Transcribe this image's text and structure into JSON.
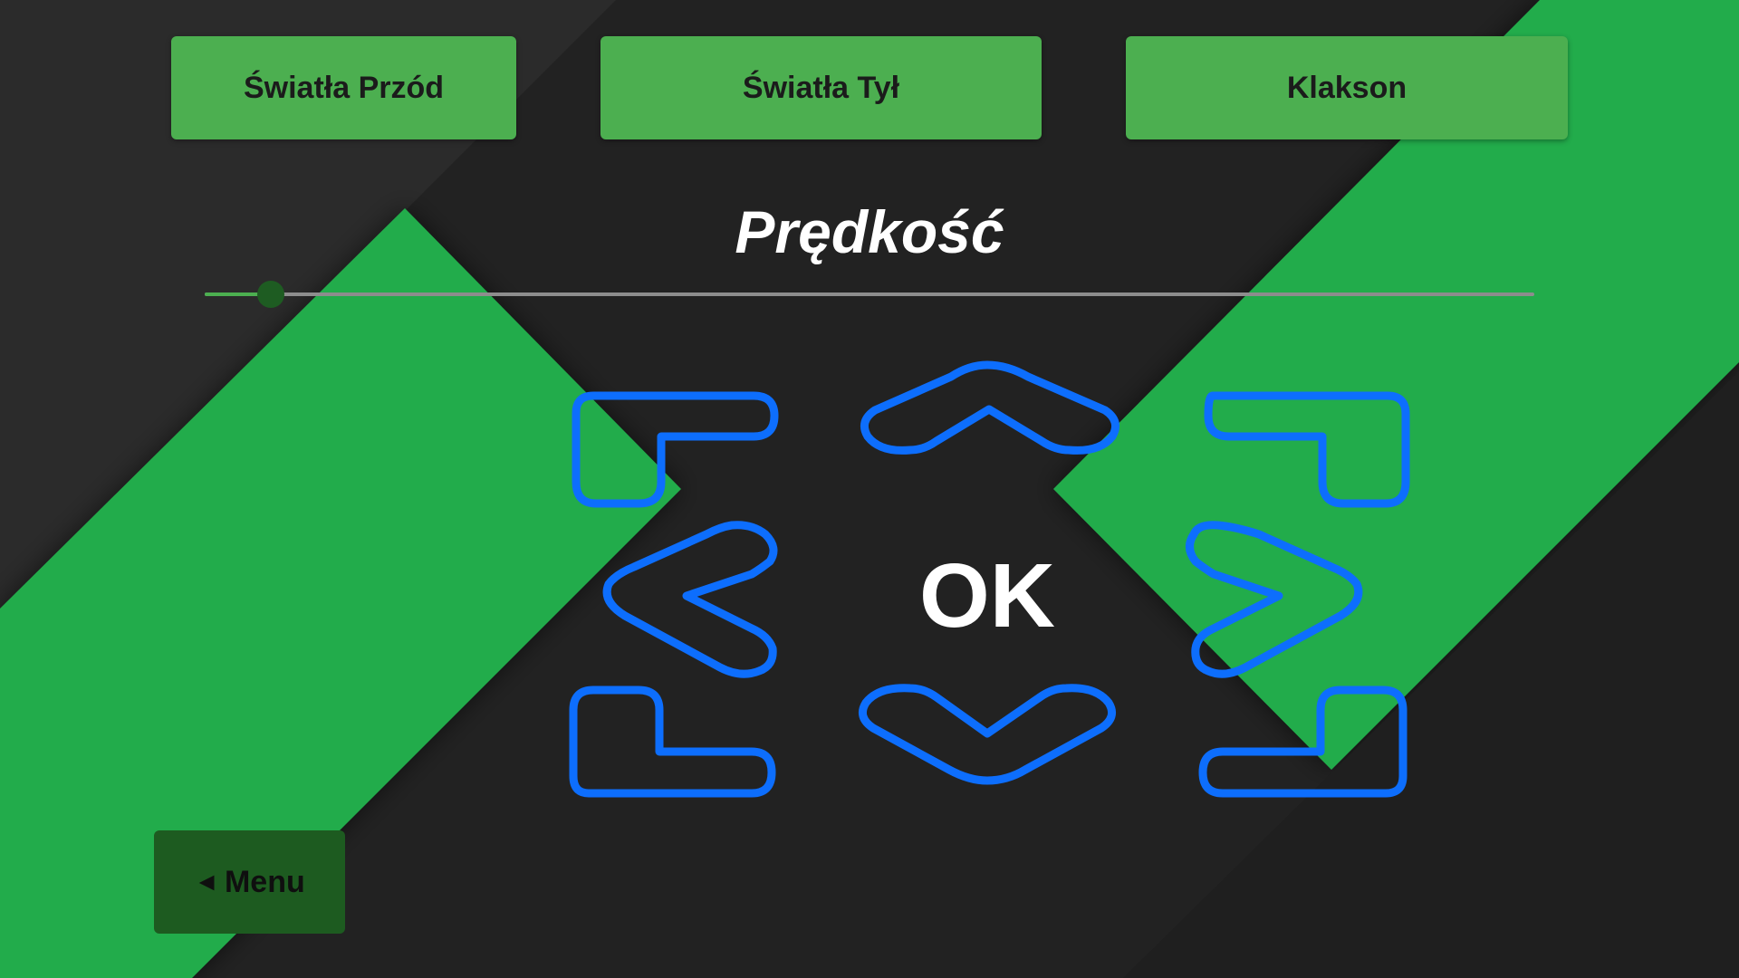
{
  "theme": {
    "background": "#222222",
    "stripe_green": "#22ac4c",
    "button_green": "#4caf50",
    "menu_green": "#1d5b20",
    "dpad_blue": "#0d6efd",
    "slider_thumb": "#1e5c22"
  },
  "top_buttons": {
    "front_lights": "Światła Przód",
    "rear_lights": "Światła Tył",
    "horn": "Klakson"
  },
  "speed": {
    "title": "Prędkość",
    "value": 5
  },
  "dpad": {
    "center_label": "OK",
    "buttons": [
      "up-left",
      "up",
      "up-right",
      "left",
      "right",
      "down-left",
      "down",
      "down-right"
    ]
  },
  "menu": {
    "arrow": "◄",
    "label": "Menu"
  }
}
